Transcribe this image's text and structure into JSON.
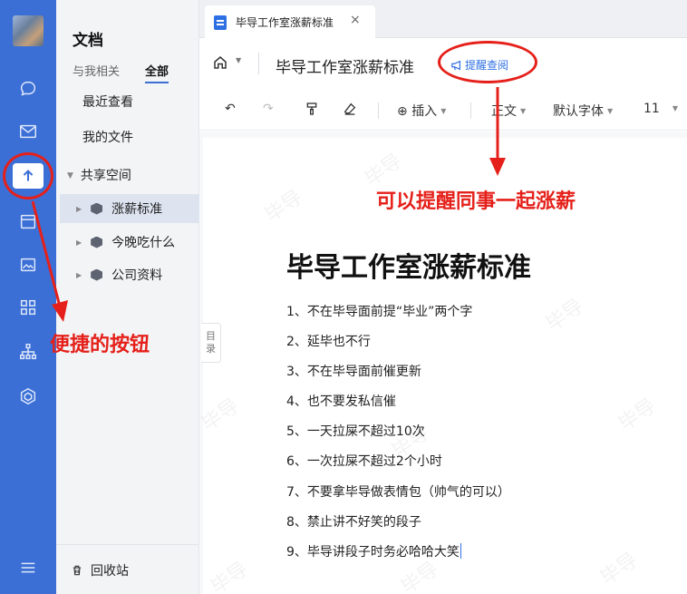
{
  "app": {
    "section_title": "文档",
    "tabs": [
      "与我相关",
      "全部"
    ],
    "nav": {
      "recent": "最近查看",
      "my_files": "我的文件"
    },
    "shared_space": {
      "label": "共享空间",
      "items": [
        "涨薪标准",
        "今晚吃什么",
        "公司资料"
      ]
    },
    "trash": "回收站"
  },
  "window": {
    "tab_title": "毕导工作室涨薪标准",
    "tab_close": "×"
  },
  "header": {
    "title": "毕导工作室涨薪标准",
    "remind_label": "提醒查阅"
  },
  "toolbar": {
    "insert": "插入",
    "style": "正文",
    "font": "默认字体",
    "size": "11"
  },
  "document": {
    "toc_label": "目录",
    "heading": "毕导工作室涨薪标准",
    "items": [
      "1、不在毕导面前提“毕业”两个字",
      "2、延毕也不行",
      "3、不在毕导面前催更新",
      "4、也不要发私信催",
      "5、一天拉屎不超过10次",
      "6、一次拉屎不超过2个小时",
      "7、不要拿毕导做表情包（帅气的可以）",
      "8、禁止讲不好笑的段子",
      "9、毕导讲段子时务必哈哈大笑"
    ],
    "watermark": "毕导"
  },
  "annotations": {
    "remind_note": "可以提醒同事一起涨薪",
    "button_note": "便捷的按钮",
    "color": "#e5201a"
  },
  "colors": {
    "rail": "#3b6fd6",
    "accent": "#2f6fe4"
  }
}
